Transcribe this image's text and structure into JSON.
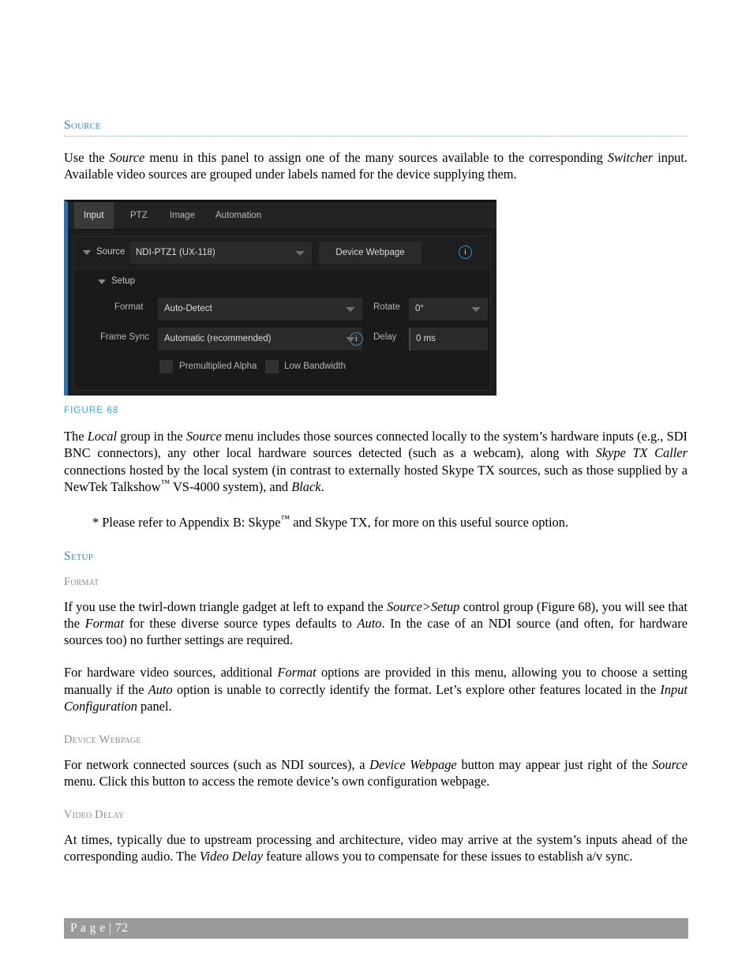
{
  "document": {
    "page_number": "72",
    "footer_label": "P a g e  |  72"
  },
  "sections": {
    "source": {
      "heading": "Source",
      "paragraph_1": "Use the Source menu in this panel to assign one of the many sources available to the corresponding Switcher input.  Available video sources are grouped under labels named for the device supplying them.",
      "paragraph_1_parts": {
        "a": "Use the ",
        "b_italic": "Source",
        "c": " menu in this panel to assign one of the many sources available to the corresponding ",
        "d_italic": "Switcher",
        "e": " input.  Available video sources are grouped under labels named for the device supplying them."
      },
      "paragraph_2_parts": {
        "a": "The ",
        "b_italic": "Local",
        "c": " group in the ",
        "d_italic": "Source",
        "e": " menu includes those sources connected locally to the system’s hardware inputs (e.g., SDI BNC connectors), any other local hardware sources detected (such as a webcam), along with ",
        "f_italic": "Skype TX Caller",
        "g": " connections hosted by the local system (in contrast to externally hosted Skype TX sources, such as those supplied by a NewTek Talkshow",
        "h_sup": "™",
        "i": " VS-4000 system), and ",
        "j_italic": "Black",
        "k": "."
      },
      "footnote_parts": {
        "a": "* Please refer to Appendix B: Skype",
        "b_sup": "™",
        "c": " and Skype TX, for more on this useful source option."
      }
    },
    "setup": {
      "heading": "Setup",
      "format": {
        "heading": "Format",
        "paragraph_1_parts": {
          "a": "If you use the twirl-down triangle gadget at left to expand the ",
          "b_italic": "Source>Setup",
          "c": " control group (Figure 68), you will see that the ",
          "d_italic": "Format",
          "e": " for these diverse source types defaults to ",
          "f_italic": "Auto",
          "g": ".  In the case of an NDI source (and often, for hardware sources too) no further settings are required."
        },
        "paragraph_2_parts": {
          "a": "For hardware video sources, additional ",
          "b_italic": "Format",
          "c": " options are provided in this menu, allowing you to choose a setting manually if the ",
          "d_italic": "Auto",
          "e": " option is unable to correctly identify the format. Let’s explore other features located in the ",
          "f_italic": "Input Configuration",
          "g": " panel."
        }
      },
      "device_webpage": {
        "heading": "Device Webpage",
        "paragraph_parts": {
          "a": "For network connected sources (such as NDI sources), a ",
          "b_italic": "Device Webpage",
          "c": " button may appear just right of the ",
          "d_italic": "Source",
          "e": " menu.  Click this button to access the remote device’s own configuration webpage."
        }
      },
      "video_delay": {
        "heading": "Video Delay",
        "paragraph_parts": {
          "a": "At times, typically due to upstream processing and architecture, video may arrive at the system’s inputs ahead of the corresponding audio.  The ",
          "b_italic": "Video Delay",
          "c": " feature allows you to compensate for these issues to establish a/v sync."
        }
      }
    }
  },
  "figure": {
    "caption": "FIGURE 68",
    "accent_color": "#1878c8",
    "panel": {
      "tabs": [
        {
          "label": "Input",
          "active": true
        },
        {
          "label": "PTZ",
          "active": false
        },
        {
          "label": "Image",
          "active": false
        },
        {
          "label": "Automation",
          "active": false
        }
      ],
      "source_row": {
        "twirl_icon": "triangle-down-icon",
        "label": "Source",
        "value": "NDI-PTZ1 (UX-118)",
        "dropdown_icon": "chevron-down-icon",
        "device_webpage_button": "Device Webpage",
        "info_icon": "info-icon",
        "info_glyph": "i"
      },
      "setup_group": {
        "twirl_icon": "triangle-down-icon",
        "label": "Setup",
        "format": {
          "label": "Format",
          "value": "Auto-Detect",
          "dropdown_icon": "chevron-down-icon"
        },
        "rotate": {
          "label": "Rotate",
          "value": "0°",
          "dropdown_icon": "chevron-down-icon"
        },
        "frame_sync": {
          "label": "Frame Sync",
          "value": "Automatic (recommended)",
          "dropdown_icon": "chevron-down-icon",
          "info_glyph": "i"
        },
        "delay": {
          "label": "Delay",
          "value": "0 ms"
        },
        "checkboxes": [
          {
            "label": "Premultiplied Alpha",
            "checked": false
          },
          {
            "label": "Low Bandwidth",
            "checked": false
          }
        ]
      }
    }
  }
}
